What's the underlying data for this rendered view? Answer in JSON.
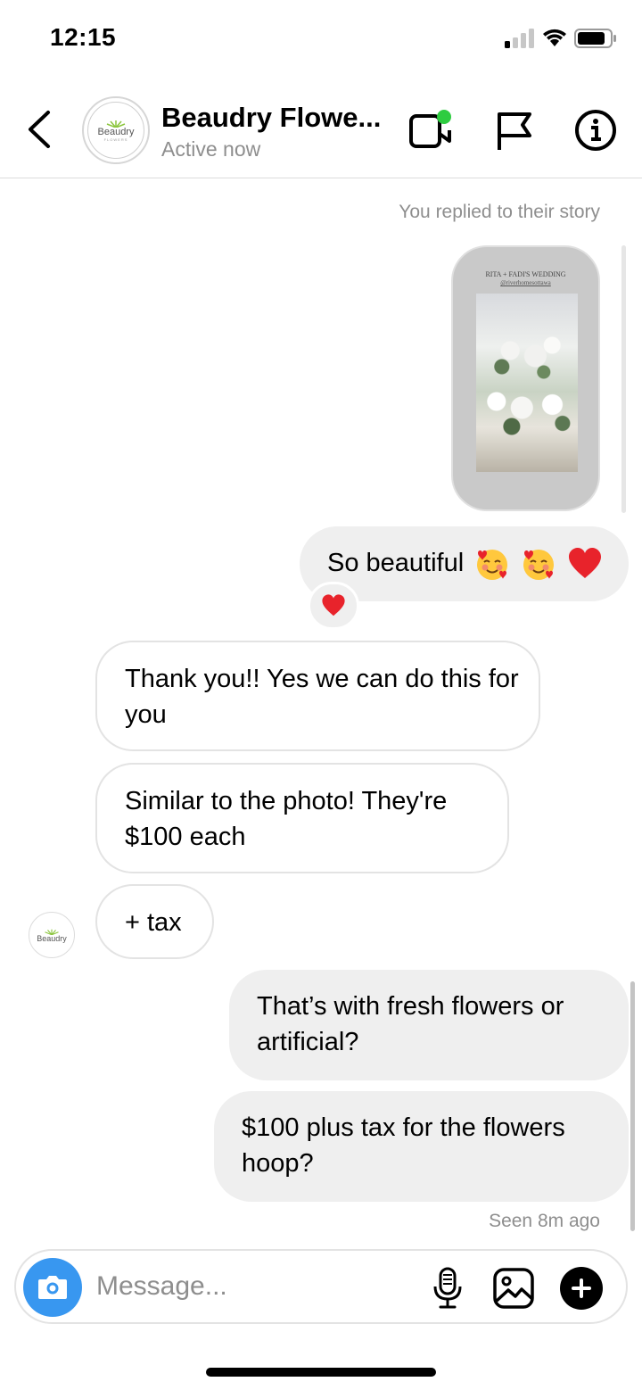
{
  "status_bar": {
    "time": "12:15"
  },
  "header": {
    "title": "Beaudry Flowe...",
    "subtitle": "Active now",
    "logo_text": "Beaudry",
    "logo_sub": "FLOWERS",
    "online_color": "#2ecc40"
  },
  "chat": {
    "story_caption": "You replied to their story",
    "story_card": {
      "title": "RITA + FADI'S WEDDING",
      "handle": "@riverhomesottawa"
    },
    "messages": [
      {
        "from": "me",
        "text": "So beautiful",
        "emojis": [
          "smiling-face-with-hearts",
          "smiling-face-with-hearts",
          "red-heart"
        ],
        "reaction": "red-heart"
      },
      {
        "from": "them",
        "text": "Thank you!! Yes we can do this for you"
      },
      {
        "from": "them",
        "text": "Similar to the photo! They're $100 each"
      },
      {
        "from": "them",
        "text": "+ tax"
      },
      {
        "from": "me",
        "text": "That’s with fresh flowers or artificial?"
      },
      {
        "from": "me",
        "text": "$100 plus tax for the flowers hoop?"
      }
    ],
    "seen": "Seen 8m ago"
  },
  "composer": {
    "placeholder": "Message...",
    "camera_color": "#3897f0"
  },
  "icons": [
    "back-chevron-icon",
    "video-call-icon",
    "flag-icon",
    "info-icon",
    "camera-icon",
    "microphone-icon",
    "gallery-icon",
    "plus-icon"
  ]
}
